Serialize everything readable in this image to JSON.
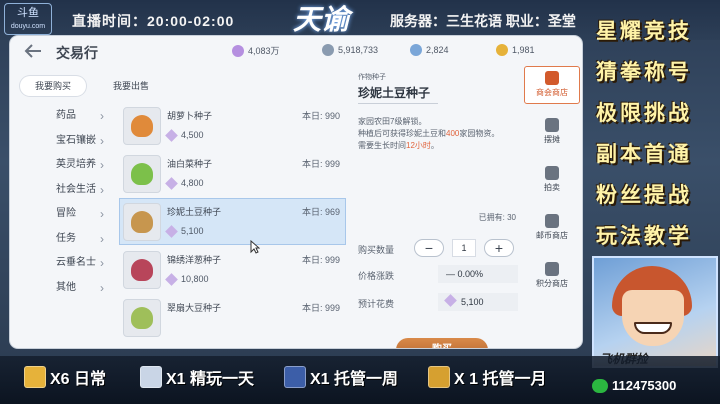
{
  "overlay": {
    "logo_line1": "斗鱼",
    "logo_line2": "douyu.com",
    "broadcast_time": "直播时间：20:00-02:00",
    "game_logo": "天谕",
    "server_info": "服务器：三生花语 职业：圣堂",
    "promos": [
      "星耀竞技",
      "猜拳称号",
      "极限挑战",
      "副本首通",
      "粉丝提战",
      "玩法教学"
    ],
    "avatar_caption": "飞机群捡",
    "tickets": [
      {
        "icon": "scroll-icon",
        "label": "X6 日常"
      },
      {
        "icon": "ticket-icon",
        "label": "X1 精玩一天"
      },
      {
        "icon": "rocket-icon",
        "label": "X1 托管一周"
      },
      {
        "icon": "trophy-icon",
        "label": "X 1 托管一月"
      }
    ],
    "wechat_id": "112475300"
  },
  "header": {
    "back_icon": "back-arrow-icon",
    "title": "交易行",
    "currencies": [
      {
        "icon": "crystal-icon",
        "value": "4,083万",
        "color": "#b58fe0"
      },
      {
        "icon": "gem-icon",
        "value": "5,918,733",
        "color": "#8a9bb0"
      },
      {
        "icon": "coin-icon",
        "value": "2,824",
        "color": "#7aa6d8"
      },
      {
        "icon": "gold-coin-icon",
        "value": "1,981",
        "color": "#e6b23a"
      }
    ]
  },
  "tabs": {
    "buy": "我要购买",
    "sell": "我要出售"
  },
  "categories": [
    "药品",
    "宝石镶嵌",
    "英灵培养",
    "社会生活",
    "冒险",
    "任务",
    "云垂名士",
    "其他"
  ],
  "items": [
    {
      "name": "胡萝卜种子",
      "price": "4,500",
      "stock": "本日: 990",
      "color": "#e08a3a"
    },
    {
      "name": "油白菜种子",
      "price": "4,800",
      "stock": "本日: 999",
      "color": "#7cc04a"
    },
    {
      "name": "珍妮土豆种子",
      "price": "5,100",
      "stock": "本日: 969",
      "color": "#c7964e"
    },
    {
      "name": "锦绣洋葱种子",
      "price": "10,800",
      "stock": "本日: 999",
      "color": "#b8455a"
    },
    {
      "name": "翠扇大豆种子",
      "price": "",
      "stock": "本日: 999",
      "color": "#9fbf5a"
    }
  ],
  "detail": {
    "type": "作物种子",
    "title": "珍妮土豆种子",
    "desc_part1": "家园农田7级解锁。",
    "desc_part2": "种植后可获得珍妮土豆和",
    "desc_hl1": "400",
    "desc_part3": "家园物资。",
    "desc_part4": "需要生长时间",
    "desc_hl2": "12小时",
    "desc_part5": "。",
    "owned": "已拥有: 30",
    "qty_label": "购买数量",
    "minus": "−",
    "qty": "1",
    "plus": "+",
    "change_label": "价格涨跌",
    "change_value": "— 0.00%",
    "cost_label": "预计花费",
    "cost_value": "5,100",
    "buy_button": "购买"
  },
  "side_nav": [
    {
      "icon": "shop-icon",
      "label": "商会商店",
      "active": true
    },
    {
      "icon": "stall-icon",
      "label": "摆摊",
      "active": false
    },
    {
      "icon": "auction-icon",
      "label": "拍卖",
      "active": false
    },
    {
      "icon": "mail-shop-icon",
      "label": "邮币商店",
      "active": false
    },
    {
      "icon": "points-shop-icon",
      "label": "积分商店",
      "active": false
    }
  ]
}
